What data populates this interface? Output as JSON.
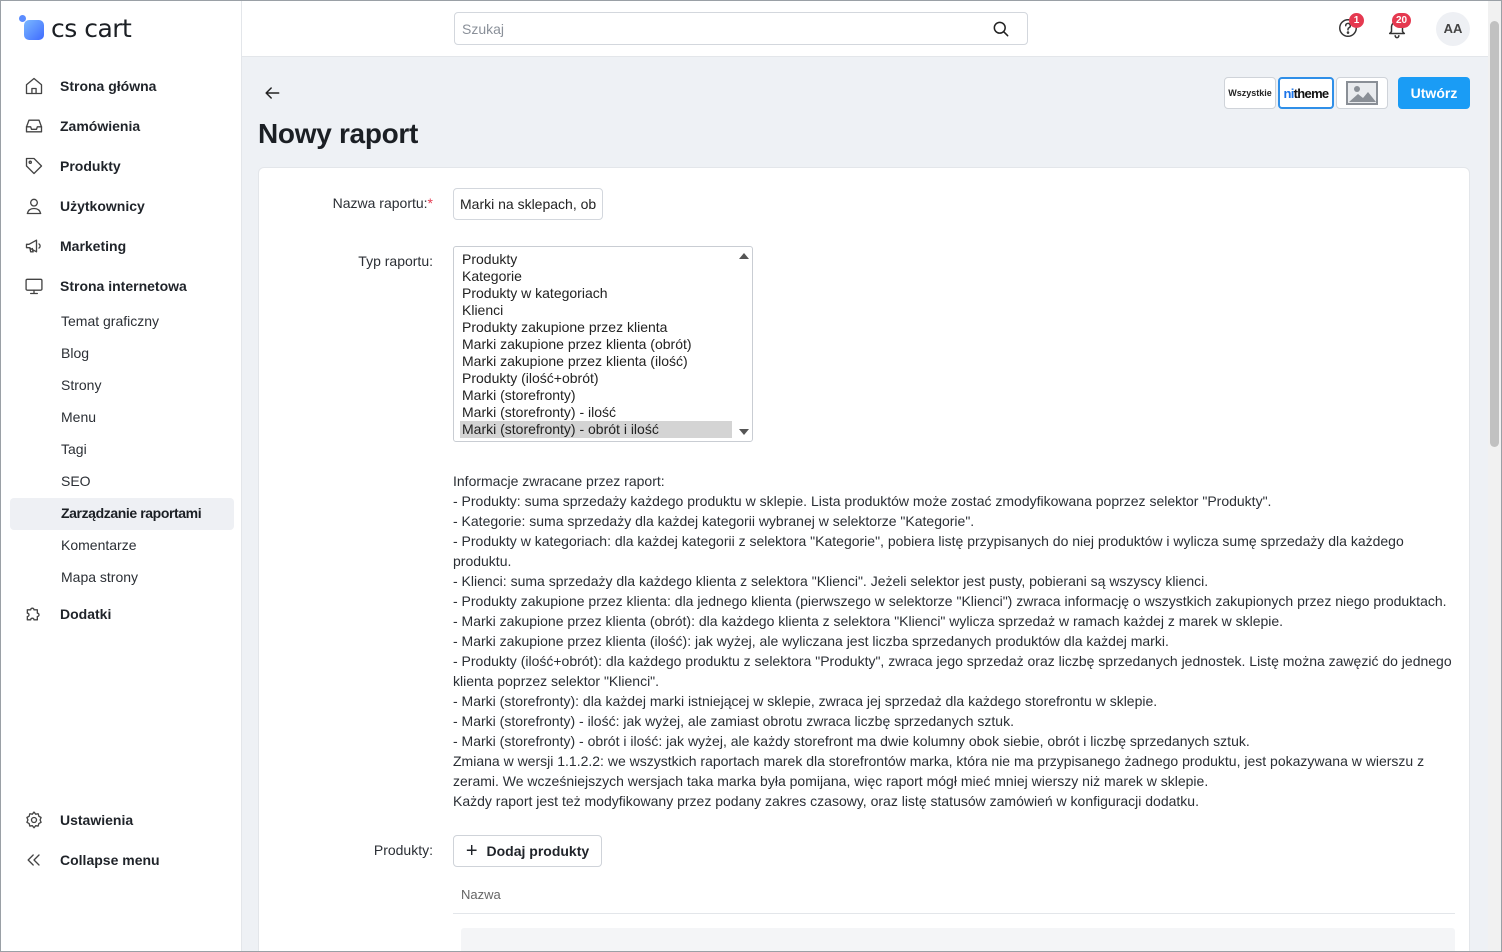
{
  "brand": {
    "name": "cs cart"
  },
  "sidebar": {
    "items": [
      {
        "label": "Strona główna",
        "icon": "home-icon"
      },
      {
        "label": "Zamówienia",
        "icon": "inbox-icon"
      },
      {
        "label": "Produkty",
        "icon": "tag-icon"
      },
      {
        "label": "Użytkownicy",
        "icon": "user-icon"
      },
      {
        "label": "Marketing",
        "icon": "megaphone-icon"
      },
      {
        "label": "Strona internetowa",
        "icon": "monitor-icon"
      }
    ],
    "subitems": [
      "Temat graficzny",
      "Blog",
      "Strony",
      "Menu",
      "Tagi",
      "SEO",
      "Zarządzanie raportami",
      "Komentarze",
      "Mapa strony"
    ],
    "active_subitem": "Zarządzanie raportami",
    "addons": {
      "label": "Dodatki",
      "icon": "puzzle-icon"
    },
    "settings": {
      "label": "Ustawienia",
      "icon": "gear-icon"
    },
    "collapse": {
      "label": "Collapse menu",
      "icon": "chevrons-left-icon"
    }
  },
  "topbar": {
    "search_placeholder": "Szukaj",
    "help_badge": "1",
    "notifications_badge": "20",
    "avatar_initials": "AA"
  },
  "header": {
    "title": "Nowy raport",
    "storefront_all": "Wszystkie",
    "storefront_theme_prefix": "ni",
    "storefront_theme_suffix": "theme",
    "create_button": "Utwórz"
  },
  "form": {
    "name_label": "Nazwa raportu:",
    "name_required": "*",
    "name_value": "Marki na sklepach, ob",
    "type_label": "Typ raportu:",
    "type_options": [
      "Produkty",
      "Kategorie",
      "Produkty w kategoriach",
      "Klienci",
      "Produkty zakupione przez klienta",
      "Marki zakupione przez klienta (obrót)",
      "Marki zakupione przez klienta (ilość)",
      "Produkty (ilość+obrót)",
      "Marki (storefronty)",
      "Marki (storefronty) - ilość",
      "Marki (storefronty) - obrót i ilość"
    ],
    "type_selected": "Marki (storefronty) - obrót i ilość",
    "info_lines": [
      "Informacje zwracane przez raport:",
      "- Produkty: suma sprzedaży każdego produktu w sklepie. Lista produktów może zostać zmodyfikowana poprzez selektor \"Produkty\".",
      "- Kategorie: suma sprzedaży dla każdej kategorii wybranej w selektorze \"Kategorie\".",
      "- Produkty w kategoriach: dla każdej kategorii z selektora \"Kategorie\", pobiera listę przypisanych do niej produktów i wylicza sumę sprzedaży dla każdego",
      "produktu.",
      "- Klienci: suma sprzedaży dla każdego klienta z selektora \"Klienci\". Jeżeli selektor jest pusty, pobierani są wszyscy klienci.",
      "- Produkty zakupione przez klienta: dla jednego klienta (pierwszego w selektorze \"Klienci\") zwraca informację o wszystkich zakupionych przez niego produktach.",
      "- Marki zakupione przez klienta (obrót): dla każdego klienta z selektora \"Klienci\" wylicza sprzedaż w ramach każdej z marek w sklepie.",
      "- Marki zakupione przez klienta (ilość): jak wyżej, ale wyliczana jest liczba sprzedanych produktów dla każdej marki.",
      "- Produkty (ilość+obrót): dla każdego produktu z selektora \"Produkty\", zwraca jego sprzedaż oraz liczbę sprzedanych jednostek. Listę można zawęzić do jednego",
      "klienta poprzez selektor \"Klienci\".",
      "- Marki (storefronty): dla każdej marki istniejącej w sklepie, zwraca jej sprzedaż dla każdego storefrontu w sklepie.",
      "- Marki (storefronty) - ilość: jak wyżej, ale zamiast obrotu zwraca liczbę sprzedanych sztuk.",
      "- Marki (storefronty) - obrót i ilość: jak wyżej, ale każdy storefront ma dwie kolumny obok siebie, obrót i liczbę sprzedanych sztuk.",
      "Zmiana w wersji 1.1.2.2: we wszystkich raportach marek dla storefrontów marka, która nie ma przypisanego żadnego produktu, jest pokazywana w wierszu z",
      "zerami. We wcześniejszych wersjach taka marka była pomijana, więc raport mógł mieć mniej wierszy niż marek w sklepie.",
      "Każdy raport jest też modyfikowany przez podany zakres czasowy, oraz listę statusów zamówień w konfiguracji dodatku."
    ],
    "products_label": "Produkty:",
    "add_products_button": "Dodaj produkty",
    "products_column_name": "Nazwa"
  },
  "colors": {
    "accent": "#1a9cf5",
    "badge": "#e53950",
    "selected_option": "#d4d4d4"
  }
}
